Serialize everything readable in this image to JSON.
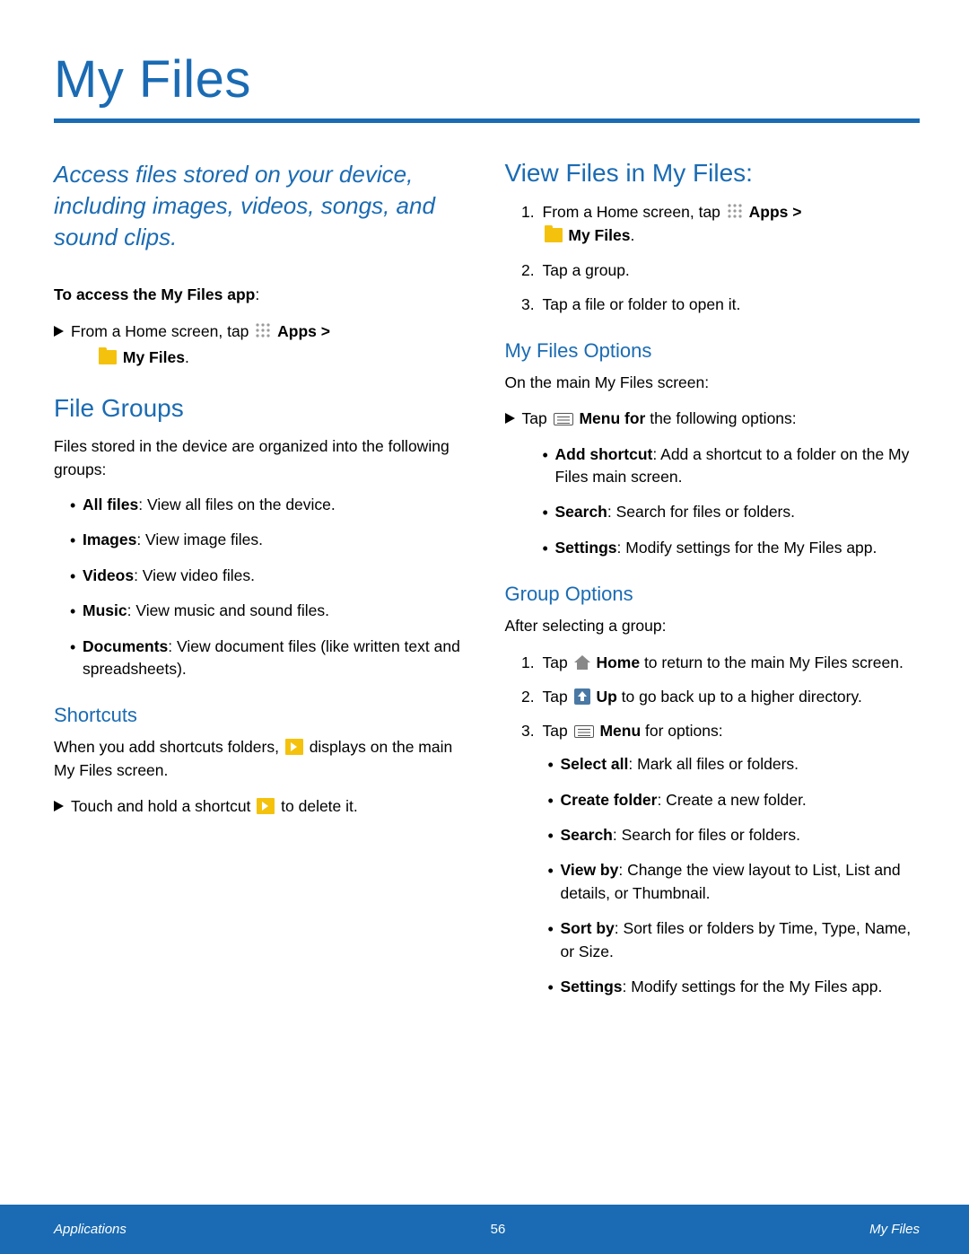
{
  "title": "My Files",
  "intro": "Access files stored on your device, including images, videos, songs, and sound clips.",
  "access_heading": "To access the My Files app",
  "access_step_pre": "From a Home screen, tap ",
  "apps_label": "Apps",
  "gt": " > ",
  "myfiles_label": "My Files",
  "section_file_groups": "File Groups",
  "file_groups_intro": "Files stored in the device are organized into the following groups:",
  "groups": [
    {
      "name": "All files",
      "desc": ": View all files on the device."
    },
    {
      "name": "Images",
      "desc": ": View image files."
    },
    {
      "name": "Videos",
      "desc": ": View video files."
    },
    {
      "name": "Music",
      "desc": ": View music and sound files."
    },
    {
      "name": "Documents",
      "desc": ": View document files (like written text and spreadsheets)."
    }
  ],
  "shortcuts_heading": "Shortcuts",
  "shortcuts_p1a": "When you add shortcuts folders, ",
  "shortcuts_p1b": " displays on the main My Files screen.",
  "shortcuts_arrow_a": "Touch and hold a shortcut ",
  "shortcuts_arrow_b": " to delete it.",
  "section_view": "View Files in My Files:",
  "view_step1_pre": "From a Home screen, tap ",
  "view_step2": "Tap a group.",
  "view_step3": "Tap a file or folder to open it.",
  "mfo_heading": "My Files Options",
  "mfo_intro": "On the main My Files screen:",
  "mfo_tap_a": "Tap ",
  "mfo_tap_b": "Menu for",
  "mfo_tap_c": " the following options:",
  "mfo_items": [
    {
      "name": "Add shortcut",
      "desc": ": Add a shortcut to a folder on the My Files main screen."
    },
    {
      "name": "Search",
      "desc": ": Search for files or folders."
    },
    {
      "name": "Settings",
      "desc": ": Modify settings for the My Files app."
    }
  ],
  "go_heading": "Group Options",
  "go_intro": "After selecting a group:",
  "go_step1_a": "Tap ",
  "go_step1_b": "Home",
  "go_step1_c": " to return to the main My Files screen.",
  "go_step2_a": "Tap ",
  "go_step2_b": "Up",
  "go_step2_c": " to go back up to a higher directory.",
  "go_step3_a": "Tap ",
  "go_step3_b": "Menu",
  "go_step3_c": " for options:",
  "go_items": [
    {
      "name": "Select all",
      "desc": ": Mark all files or folders."
    },
    {
      "name": "Create folder",
      "desc": ": Create a new folder."
    },
    {
      "name": "Search",
      "desc": ": Search for files or folders."
    },
    {
      "name": "View by",
      "desc": ": Change the view layout to List, List and details, or Thumbnail."
    },
    {
      "name": "Sort by",
      "desc": ": Sort files or folders by Time, Type, Name, or Size."
    },
    {
      "name": "Settings",
      "desc": ": Modify settings for the My Files app."
    }
  ],
  "footer": {
    "left": "Applications",
    "center": "56",
    "right": "My Files"
  }
}
